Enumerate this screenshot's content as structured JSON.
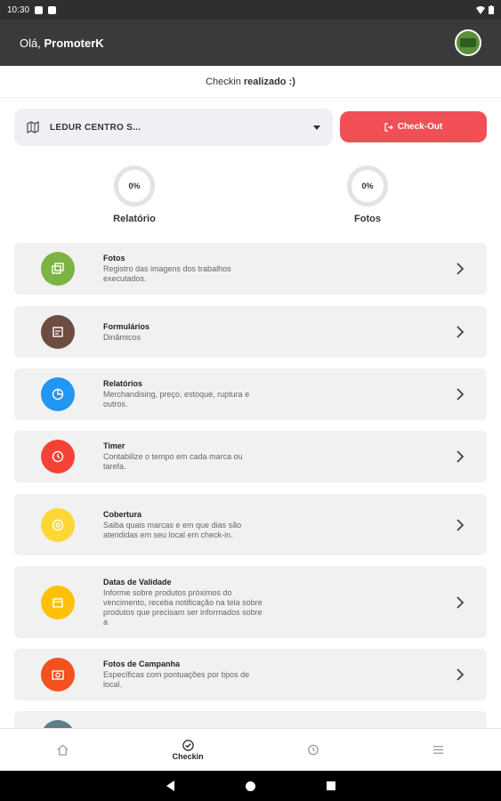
{
  "status_bar": {
    "time": "10:30"
  },
  "header": {
    "greeting_prefix": "Olá,",
    "user_name": "PromoterK"
  },
  "checkin_status": {
    "prefix": "Checkin",
    "state": "realizado :)"
  },
  "store": {
    "selected": "LEDUR CENTRO S..."
  },
  "checkout_button": {
    "label": "Check-Out"
  },
  "progress": [
    {
      "label": "Relatório",
      "value": "0%"
    },
    {
      "label": "Fotos",
      "value": "0%"
    }
  ],
  "menu": [
    {
      "title": "Fotos",
      "desc": "Registro das imagens dos trabalhos executados.",
      "icon": "photos-icon",
      "color": "#7cb342"
    },
    {
      "title": "Formulários",
      "desc": "Dinâmicos",
      "icon": "form-icon",
      "color": "#6d4c41"
    },
    {
      "title": "Relatórios",
      "desc": "Merchandising, preço, estoque, ruptura e outros.",
      "icon": "report-icon",
      "color": "#2196f3"
    },
    {
      "title": "Timer",
      "desc": "Contabilize o tempo em cada marca ou tarefa.",
      "icon": "timer-icon",
      "color": "#f44336"
    },
    {
      "title": "Cobertura",
      "desc": "Saiba quais marcas e em que dias são atendidas em seu local em check-in.",
      "icon": "coverage-icon",
      "color": "#fdd835"
    },
    {
      "title": "Datas de Validade",
      "desc": "Informe sobre produtos próximos do vencimento, receba notificação na tela sobre produtos que precisam ser informados sobre a",
      "icon": "calendar-icon",
      "color": "#ffc107"
    },
    {
      "title": "Fotos de Campanha",
      "desc": "Específicas com pontuações por tipos de local.",
      "icon": "camera-icon",
      "color": "#f4511e"
    }
  ],
  "bottom_nav": [
    {
      "label": "",
      "icon": "home-icon"
    },
    {
      "label": "Checkin",
      "icon": "check-circle-icon"
    },
    {
      "label": "",
      "icon": "history-icon"
    },
    {
      "label": "",
      "icon": "menu-icon"
    }
  ],
  "colors": {
    "appbar": "#3a3a3a",
    "accent_red": "#f05055",
    "card_bg": "#f1f1f1"
  }
}
